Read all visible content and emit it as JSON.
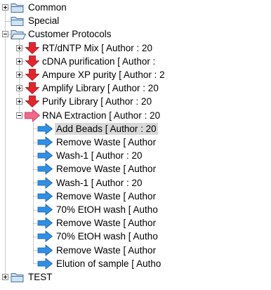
{
  "tree": {
    "nodes": [
      {
        "label": "Common",
        "level": 0,
        "icon": "folder-icon",
        "expander": "plus"
      },
      {
        "label": "Special",
        "level": 0,
        "icon": "folder-icon",
        "expander": "none"
      },
      {
        "label": "Customer Protocols",
        "level": 0,
        "icon": "folder-open-icon",
        "expander": "minus"
      },
      {
        "label": "RT/dNTP Mix [ Author : 20",
        "level": 1,
        "icon": "red-down-arrow-icon",
        "expander": "plus"
      },
      {
        "label": "cDNA purification [ Author :",
        "level": 1,
        "icon": "red-down-arrow-icon",
        "expander": "plus"
      },
      {
        "label": "Ampure XP purity [ Author : 2",
        "level": 1,
        "icon": "red-down-arrow-icon",
        "expander": "plus"
      },
      {
        "label": "Amplify Library [ Author : 20",
        "level": 1,
        "icon": "red-down-arrow-icon",
        "expander": "plus"
      },
      {
        "label": "Purify Library [ Author : 20",
        "level": 1,
        "icon": "red-down-arrow-icon",
        "expander": "plus"
      },
      {
        "label": "RNA Extraction [ Author : 20",
        "level": 1,
        "icon": "red-right-arrow-icon",
        "expander": "minus"
      },
      {
        "label": "Add Beads [ Author : 20",
        "level": 2,
        "icon": "blue-right-arrow-icon",
        "expander": "none",
        "selected": true
      },
      {
        "label": "Remove Waste [ Author",
        "level": 2,
        "icon": "blue-right-arrow-icon",
        "expander": "none"
      },
      {
        "label": "Wash-1 [ Author : 20",
        "level": 2,
        "icon": "blue-right-arrow-icon",
        "expander": "none"
      },
      {
        "label": "Remove Waste [ Author",
        "level": 2,
        "icon": "blue-right-arrow-icon",
        "expander": "none"
      },
      {
        "label": "Wash-1 [ Author : 20",
        "level": 2,
        "icon": "blue-right-arrow-icon",
        "expander": "none"
      },
      {
        "label": "Remove Waste [ Author",
        "level": 2,
        "icon": "blue-right-arrow-icon",
        "expander": "none"
      },
      {
        "label": "70% EtOH wash [ Autho",
        "level": 2,
        "icon": "blue-right-arrow-icon",
        "expander": "none"
      },
      {
        "label": "Remove Waste [ Author",
        "level": 2,
        "icon": "blue-right-arrow-icon",
        "expander": "none"
      },
      {
        "label": "70% EtOH wash [ Autho",
        "level": 2,
        "icon": "blue-right-arrow-icon",
        "expander": "none"
      },
      {
        "label": "Remove Waste [ Author",
        "level": 2,
        "icon": "blue-right-arrow-icon",
        "expander": "none"
      },
      {
        "label": "Elution of sample [ Autho",
        "level": 2,
        "icon": "blue-right-arrow-icon",
        "expander": "none"
      },
      {
        "label": "TEST",
        "level": 0,
        "icon": "folder-icon",
        "expander": "plus"
      }
    ]
  },
  "colors": {
    "tree_line": "#9a9a9a",
    "selection": "#d9d9d9",
    "folder_fill": "#cfe3f5",
    "folder_edge": "#4a6f95",
    "red_arrow": "#e3262e",
    "pink_arrow": "#f06a8a",
    "blue_arrow": "#2f8fe6"
  }
}
